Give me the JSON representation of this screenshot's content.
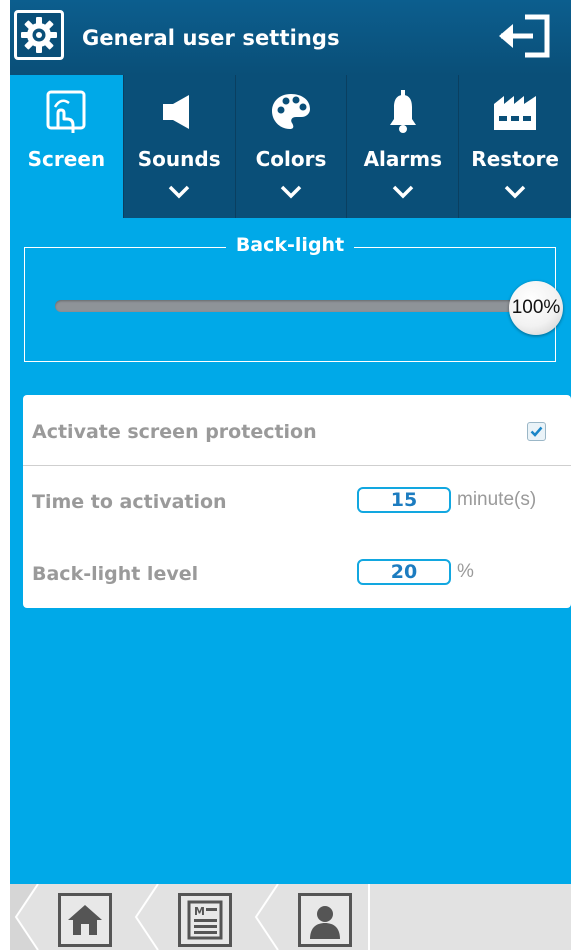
{
  "header": {
    "title": "General user settings",
    "settings_icon": "gear-icon",
    "exit_icon": "exit-icon"
  },
  "tabs": [
    {
      "label": "Screen",
      "icon": "touch-screen-icon",
      "active": true
    },
    {
      "label": "Sounds",
      "icon": "speaker-icon",
      "active": false
    },
    {
      "label": "Colors",
      "icon": "palette-icon",
      "active": false
    },
    {
      "label": "Alarms",
      "icon": "bell-icon",
      "active": false
    },
    {
      "label": "Restore",
      "icon": "factory-icon",
      "active": false
    }
  ],
  "backlight": {
    "legend": "Back-light",
    "value_label": "100%",
    "value": 100
  },
  "protection": {
    "activate_label": "Activate screen protection",
    "activate_checked": true,
    "time_label": "Time to activation",
    "time_value": "15",
    "time_unit": "minute(s)",
    "level_label": "Back-light level",
    "level_value": "20",
    "level_unit": "%"
  },
  "bottom_nav": [
    {
      "icon": "home-icon"
    },
    {
      "icon": "menu-list-icon"
    },
    {
      "icon": "user-icon"
    }
  ],
  "colors": {
    "accent": "#00a9e8",
    "header": "#0a4f78"
  }
}
